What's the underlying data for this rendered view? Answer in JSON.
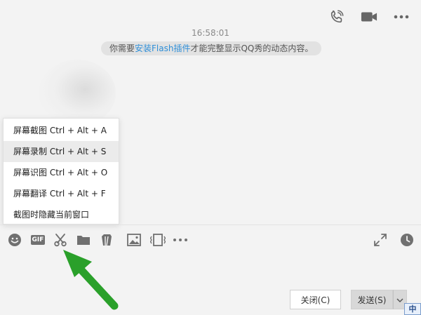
{
  "header": {
    "icons": [
      "phone-icon",
      "video-call-icon",
      "more-icon"
    ]
  },
  "chat": {
    "timestamp": "16:58:01",
    "notice_pre": "你需要",
    "notice_link": "安装Flash插件",
    "notice_post": "才能完整显示QQ秀的动态内容。"
  },
  "screenshot_menu": {
    "items": [
      {
        "label": "屏幕截图 Ctrl + Alt + A"
      },
      {
        "label": "屏幕录制 Ctrl + Alt + S"
      },
      {
        "label": "屏幕识图 Ctrl + Alt + O"
      },
      {
        "label": "屏幕翻译 Ctrl + Alt + F"
      },
      {
        "label": "截图时隐藏当前窗口"
      }
    ],
    "hovered_index": 1
  },
  "toolbar": {
    "gif_label": "GIF",
    "left_icons": [
      "emoji-icon",
      "gif-icon",
      "scissors-icon",
      "folder-icon",
      "gift-icon",
      "image-icon",
      "screen-share-icon",
      "more-icon"
    ],
    "right_icons": [
      "expand-icon",
      "history-icon"
    ]
  },
  "actions": {
    "close_label": "关闭(C)",
    "send_label": "发送(S)"
  },
  "ime": {
    "label": "中"
  },
  "colors": {
    "background": "#f3f3f3",
    "link": "#2f8fd8",
    "arrow": "#2aa02a",
    "icon": "#707070"
  }
}
